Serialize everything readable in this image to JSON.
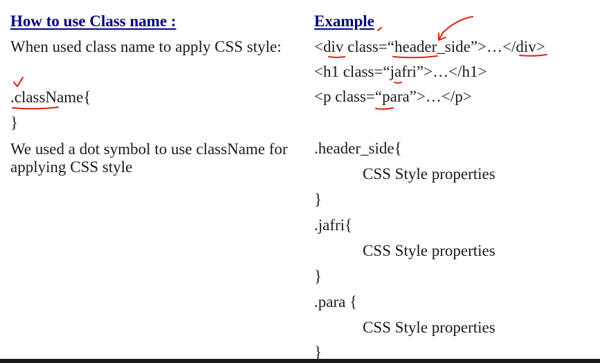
{
  "left": {
    "heading": "How to use Class name :",
    "intro": "When used class name to apply CSS style:",
    "selector_open": ".className{",
    "selector_close": "}",
    "note_line1": "We used a dot symbol to use className for",
    "note_line2": "applying CSS style"
  },
  "right": {
    "heading": "Example",
    "html_lines": [
      "<div class=“header_side”>…</div>",
      "<h1 class=“jafri”>…</h1>",
      "<p class=“para”>…</p>"
    ],
    "css_blocks": [
      {
        "open": ".header_side{",
        "body": "CSS Style properties",
        "close": "}"
      },
      {
        "open": ".jafri{",
        "body": "CSS Style properties",
        "close": "}"
      },
      {
        "open": ".para {",
        "body": "CSS Style properties",
        "close": "}"
      }
    ]
  },
  "colors": {
    "heading": "#000080",
    "text": "#1a1a1a",
    "annotation": "#e0200f",
    "bottom_bar": "#1b1b1b"
  }
}
